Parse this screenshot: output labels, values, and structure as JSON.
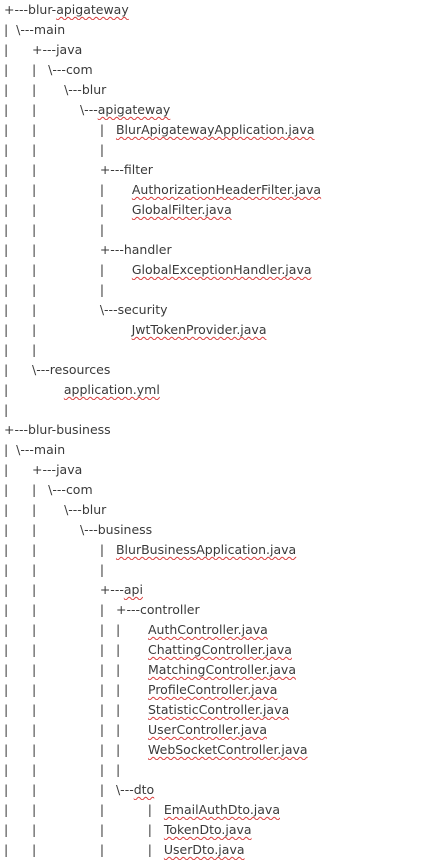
{
  "document": {
    "lines": [
      {
        "prefix": "+---",
        "text": "blur-apigateway",
        "spell": [
          [
            "",
            "blur-"
          ],
          [
            "s",
            "apigateway"
          ]
        ]
      },
      {
        "prefix": "|  \\---",
        "text": "main"
      },
      {
        "prefix": "|      +---",
        "text": "java"
      },
      {
        "prefix": "|      |   \\---",
        "text": "com"
      },
      {
        "prefix": "|      |       \\---",
        "text": "blur"
      },
      {
        "prefix": "|      |           \\---",
        "text": "apigateway",
        "spell": [
          [
            "s",
            "apigateway"
          ]
        ]
      },
      {
        "prefix": "|      |                |   ",
        "text": "BlurApigatewayApplication.java",
        "spell": [
          [
            "s",
            "BlurApigatewayApplication.java"
          ]
        ]
      },
      {
        "prefix": "|      |                |",
        "text": ""
      },
      {
        "prefix": "|      |                +---",
        "text": "filter"
      },
      {
        "prefix": "|      |                |       ",
        "text": "AuthorizationHeaderFilter.java",
        "spell": [
          [
            "s",
            "AuthorizationHeaderFilter.java"
          ]
        ]
      },
      {
        "prefix": "|      |                |       ",
        "text": "GlobalFilter.java",
        "spell": [
          [
            "s",
            "GlobalFilter.java"
          ]
        ]
      },
      {
        "prefix": "|      |                |",
        "text": ""
      },
      {
        "prefix": "|      |                +---",
        "text": "handler"
      },
      {
        "prefix": "|      |                |       ",
        "text": "GlobalExceptionHandler.java",
        "spell": [
          [
            "s",
            "GlobalExceptionHandler.java"
          ]
        ]
      },
      {
        "prefix": "|      |                |",
        "text": ""
      },
      {
        "prefix": "|      |                \\---",
        "text": "security"
      },
      {
        "prefix": "|      |                        ",
        "text": "JwtTokenProvider.java",
        "spell": [
          [
            "s",
            "JwtTokenProvider.java"
          ]
        ]
      },
      {
        "prefix": "|      |",
        "text": ""
      },
      {
        "prefix": "|      \\---",
        "text": "resources"
      },
      {
        "prefix": "|              ",
        "text": "application.yml",
        "spell": [
          [
            "s",
            "application.yml"
          ]
        ]
      },
      {
        "prefix": "|",
        "text": ""
      },
      {
        "prefix": "+---",
        "text": "blur-business"
      },
      {
        "prefix": "|  \\---",
        "text": "main"
      },
      {
        "prefix": "|      +---",
        "text": "java"
      },
      {
        "prefix": "|      |   \\---",
        "text": "com"
      },
      {
        "prefix": "|      |       \\---",
        "text": "blur"
      },
      {
        "prefix": "|      |           \\---",
        "text": "business"
      },
      {
        "prefix": "|      |                |   ",
        "text": "BlurBusinessApplication.java",
        "spell": [
          [
            "s",
            "BlurBusinessApplication.java"
          ]
        ]
      },
      {
        "prefix": "|      |                |",
        "text": ""
      },
      {
        "prefix": "|      |                +---",
        "text": "api",
        "spell": [
          [
            "s",
            "api"
          ]
        ]
      },
      {
        "prefix": "|      |                |   +---",
        "text": "controller"
      },
      {
        "prefix": "|      |                |   |       ",
        "text": "AuthController.java",
        "spell": [
          [
            "s",
            "AuthController.java"
          ]
        ]
      },
      {
        "prefix": "|      |                |   |       ",
        "text": "ChattingController.java",
        "spell": [
          [
            "s",
            "ChattingController.java"
          ]
        ]
      },
      {
        "prefix": "|      |                |   |       ",
        "text": "MatchingController.java",
        "spell": [
          [
            "s",
            "MatchingController.java"
          ]
        ]
      },
      {
        "prefix": "|      |                |   |       ",
        "text": "ProfileController.java",
        "spell": [
          [
            "s",
            "ProfileController.java"
          ]
        ]
      },
      {
        "prefix": "|      |                |   |       ",
        "text": "StatisticController.java",
        "spell": [
          [
            "s",
            "StatisticController.java"
          ]
        ]
      },
      {
        "prefix": "|      |                |   |       ",
        "text": "UserController.java",
        "spell": [
          [
            "s",
            "UserController.java"
          ]
        ]
      },
      {
        "prefix": "|      |                |   |       ",
        "text": "WebSocketController.java",
        "spell": [
          [
            "s",
            "WebSocketController.java"
          ]
        ]
      },
      {
        "prefix": "|      |                |   |",
        "text": ""
      },
      {
        "prefix": "|      |                |   \\---",
        "text": "dto",
        "spell": [
          [
            "s",
            "dto"
          ]
        ]
      },
      {
        "prefix": "|      |                |           |   ",
        "text": "EmailAuthDto.java",
        "spell": [
          [
            "s",
            "EmailAuthDto.java"
          ]
        ]
      },
      {
        "prefix": "|      |                |           |   ",
        "text": "TokenDto.java",
        "spell": [
          [
            "s",
            "TokenDto.java"
          ]
        ]
      },
      {
        "prefix": "|      |                |           |   ",
        "text": "UserDto.java",
        "spell": [
          [
            "s",
            "UserDto.java"
          ]
        ]
      }
    ]
  }
}
